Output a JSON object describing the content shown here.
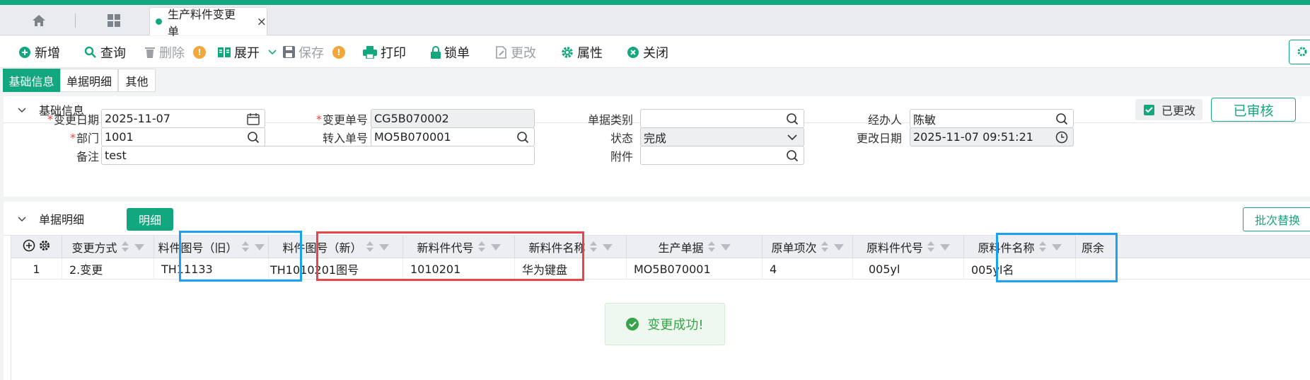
{
  "tabs": {
    "home_icon": "home-icon",
    "apps_icon": "apps-grid-icon",
    "doc_tab_label": "生产料件变更单",
    "close_glyph": "×"
  },
  "toolbar": {
    "add": "新增",
    "query": "查询",
    "delete": "删除",
    "expand": "展开",
    "save": "保存",
    "print": "打印",
    "lock": "锁单",
    "modify": "更改",
    "properties": "属性",
    "close": "关闭",
    "warn_glyph": "!"
  },
  "subtabs": [
    "基础信息",
    "单据明细",
    "其他"
  ],
  "basic": {
    "section_title": "基础信息",
    "modified_label": "已更改",
    "audit_label": "已审核",
    "fields": {
      "change_date_label": "变更日期",
      "change_date": "2025-11-07",
      "change_no_label": "变更单号",
      "change_no": "CG5B070002",
      "doc_type_label": "单据类别",
      "doc_type": "",
      "handler_label": "经办人",
      "handler": "陈敏",
      "dept_label": "部门",
      "dept": "1001",
      "transfer_no_label": "转入单号",
      "transfer_no": "MO5B070001",
      "status_label": "状态",
      "status": "完成",
      "modify_date_label": "更改日期",
      "modify_date": "2025-11-07 09:51:21",
      "remark_label": "备注",
      "remark": "test",
      "attachment_label": "附件",
      "attachment": ""
    }
  },
  "detail": {
    "section_title": "单据明细",
    "detail_button": "明细",
    "batch_button": "批次替换",
    "columns": [
      "变更方式",
      "料件图号（旧）",
      "料件图号（新）",
      "新料件代号",
      "新料件名称",
      "生产单据",
      "原单项次",
      "原料件代号",
      "原料件名称",
      "原余"
    ],
    "rows": [
      {
        "idx": "1",
        "change_type": "2.变更",
        "old_drawing": "TH11133",
        "new_drawing": "TH1010201图号",
        "new_code": "1010201",
        "new_name": "华为键盘",
        "prod_doc": "MO5B070001",
        "orig_item": "4",
        "orig_code": "005yl",
        "orig_name": "005yl名"
      }
    ]
  },
  "toast": {
    "message": "变更成功!"
  },
  "colors": {
    "accent": "#13a77f",
    "highlight_blue": "#1aa1ef",
    "highlight_red": "#e8454a",
    "warn": "#f3a73b"
  }
}
